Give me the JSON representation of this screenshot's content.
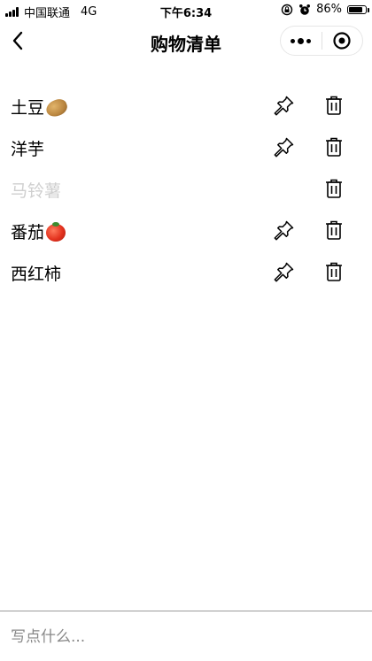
{
  "status_bar": {
    "carrier": "中国联通",
    "network": "4G",
    "time": "下午6:34",
    "battery_text": "86%",
    "battery_level": 0.86
  },
  "nav": {
    "title": "购物清单",
    "back_icon": "chevron-left-icon",
    "more_icon": "more-dots-icon",
    "close_icon": "target-circle-icon"
  },
  "items": [
    {
      "label": "土豆",
      "emoji": "potato",
      "completed": false,
      "pinnable": true
    },
    {
      "label": "洋芋",
      "emoji": "",
      "completed": false,
      "pinnable": true
    },
    {
      "label": "马铃薯",
      "emoji": "",
      "completed": true,
      "pinnable": false
    },
    {
      "label": "番茄",
      "emoji": "tomato",
      "completed": false,
      "pinnable": true
    },
    {
      "label": "西红柿",
      "emoji": "",
      "completed": false,
      "pinnable": true
    }
  ],
  "input": {
    "placeholder": "写点什么...",
    "value": ""
  },
  "colors": {
    "completed_text": "#cfcfcf",
    "placeholder": "#888888",
    "divider": "#9a9a9a"
  }
}
